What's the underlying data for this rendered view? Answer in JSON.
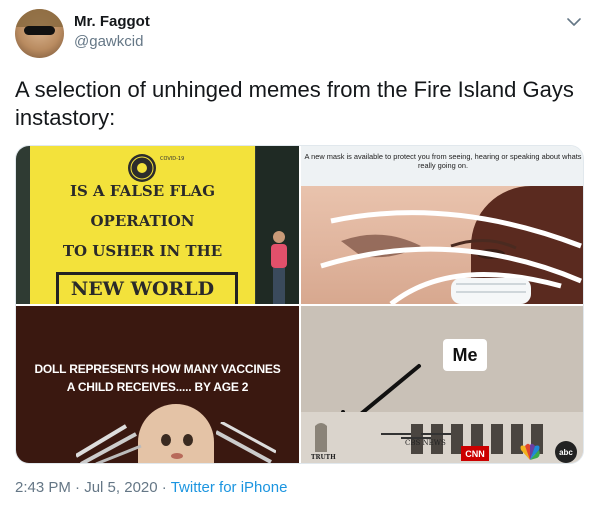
{
  "user": {
    "display_name": "Mr. Faggot",
    "handle": "@gawkcid"
  },
  "tweet": {
    "text": "A selection of unhinged memes from the Fire Island Gays instastory:",
    "time": "2:43 PM",
    "separator": "·",
    "date": "Jul 5, 2020",
    "source": "Twitter for iPhone"
  },
  "media": {
    "image1": {
      "sign_lines": [
        "IS A FALSE FLAG",
        "OPERATION",
        "TO USHER IN THE",
        "NEW WORLD"
      ],
      "seal_text": "COVID-19"
    },
    "image2": {
      "caption": "A new mask is available to protect you from seeing, hearing or speaking about whats really going on."
    },
    "image3": {
      "lines": [
        "DOLL REPRESENTS HOW MANY VACCINES",
        "A CHILD RECEIVES..... BY AGE 2"
      ]
    },
    "image4": {
      "label": "Me",
      "truth": "TRUTH",
      "logos": [
        "CBS NEWS",
        "CNN",
        "NBC",
        "abc"
      ]
    }
  },
  "colors": {
    "text": "#14171a",
    "secondary": "#657786",
    "link": "#1b95e0",
    "sign_yellow": "#f3e23b"
  },
  "icons": {
    "more": "chevron-down-icon"
  }
}
